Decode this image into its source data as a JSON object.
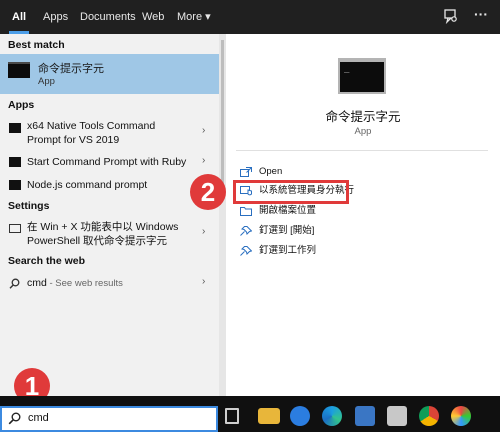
{
  "filter_tabs": [
    "All",
    "Apps",
    "Documents",
    "Web",
    "More"
  ],
  "more_chevron": "▾",
  "top_icons": [
    "feedback-icon",
    "more-options-icon"
  ],
  "more_options_glyph": "···",
  "best_match": {
    "heading": "Best match",
    "title": "命令提示字元",
    "type": "App",
    "icon": "command-prompt-icon"
  },
  "apps": {
    "heading": "Apps",
    "items": [
      {
        "line1": "x64 Native Tools Command",
        "line2": "Prompt for VS 2019"
      },
      {
        "line1": "Start Command Prompt with Ruby",
        "line2": ""
      },
      {
        "line1": "Node.js command prompt",
        "line2": ""
      }
    ]
  },
  "settings": {
    "heading": "Settings",
    "items": [
      {
        "line1": "在 Win + X 功能表中以 Windows",
        "line2": "PowerShell 取代命令提示字元"
      }
    ]
  },
  "web": {
    "heading": "Search the web",
    "query": "cmd",
    "suffix": " - See web results"
  },
  "chevron": "›",
  "detail": {
    "title": "命令提示字元",
    "subtitle": "App",
    "actions": [
      {
        "label": "Open",
        "icon": "open-icon"
      },
      {
        "label": "以系統管理員身分執行",
        "icon": "run-as-admin-icon"
      },
      {
        "label": "開啟檔案位置",
        "icon": "folder-location-icon"
      },
      {
        "label": "釘選到 [開始]",
        "icon": "pin-to-start-icon"
      },
      {
        "label": "釘選到工作列",
        "icon": "pin-to-taskbar-icon"
      }
    ]
  },
  "callouts": {
    "one": "1",
    "two": "2"
  },
  "colors": {
    "accent": "#4c9ee8",
    "selection": "#9fc7e6",
    "callout": "#e03a3a"
  },
  "search_box": {
    "value": "cmd"
  },
  "taskbar_icons": [
    "task-view-icon",
    "file-explorer-icon",
    "edge-legacy-icon",
    "edge-icon",
    "store-icon",
    "paint-icon",
    "chrome-icon",
    "paint-palette-icon"
  ]
}
